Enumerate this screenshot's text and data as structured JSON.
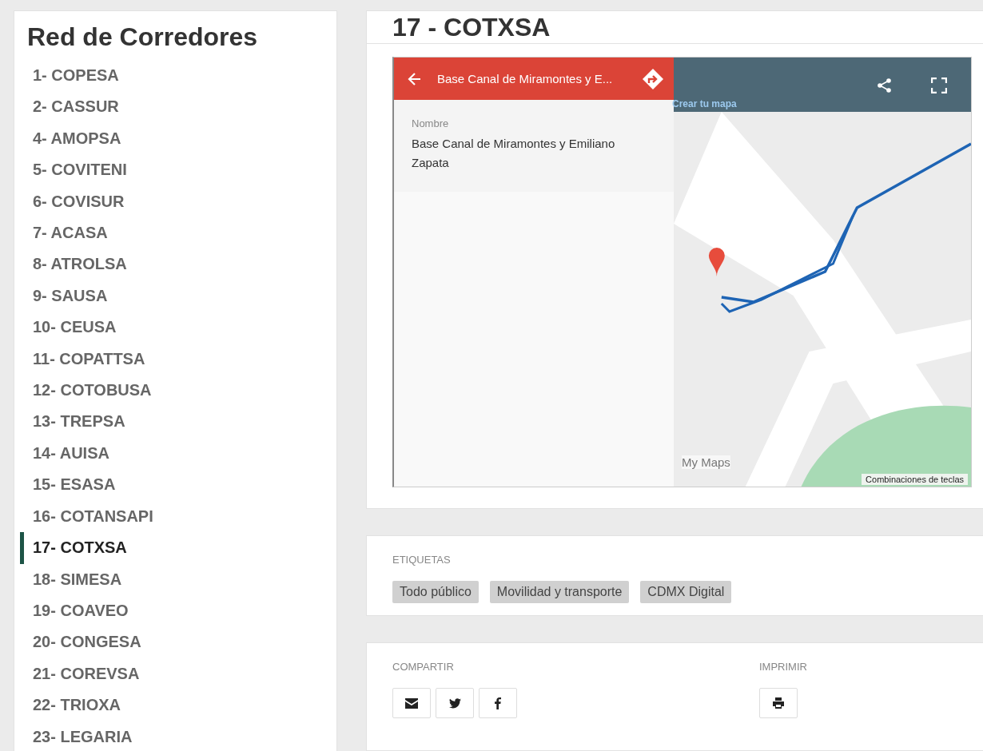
{
  "sidebar": {
    "title": "Red de Corredores",
    "items": [
      {
        "label": "1- COPESA",
        "selected": false
      },
      {
        "label": "2- CASSUR",
        "selected": false
      },
      {
        "label": "4- AMOPSA",
        "selected": false
      },
      {
        "label": "5- COVITENI",
        "selected": false
      },
      {
        "label": "6- COVISUR",
        "selected": false
      },
      {
        "label": "7- ACASA",
        "selected": false
      },
      {
        "label": "8- ATROLSA",
        "selected": false
      },
      {
        "label": "9- SAUSA",
        "selected": false
      },
      {
        "label": "10- CEUSA",
        "selected": false
      },
      {
        "label": "11- COPATTSA",
        "selected": false
      },
      {
        "label": "12- COTOBUSA",
        "selected": false
      },
      {
        "label": "13- TREPSA",
        "selected": false
      },
      {
        "label": "14- AUISA",
        "selected": false
      },
      {
        "label": "15- ESASA",
        "selected": false
      },
      {
        "label": "16- COTANSAPI",
        "selected": false
      },
      {
        "label": "17- COTXSA",
        "selected": true
      },
      {
        "label": "18- SIMESA",
        "selected": false
      },
      {
        "label": "19- COAVEO",
        "selected": false
      },
      {
        "label": "20- CONGESA",
        "selected": false
      },
      {
        "label": "21- COREVSA",
        "selected": false
      },
      {
        "label": "22- TRIOXA",
        "selected": false
      },
      {
        "label": "23- LEGARIA",
        "selected": false
      }
    ]
  },
  "page_title": "17 - COTXSA",
  "map": {
    "panel_title": "Base Canal de Miramontes y E...",
    "field_label": "Nombre",
    "field_value": "Base Canal de Miramontes y Emiliano Zapata",
    "create_link": "Crear tu mapa",
    "brand": "My Maps",
    "shortcuts": "Combinaciones de teclas"
  },
  "tags": {
    "heading": "ETIQUETAS",
    "items": [
      "Todo público",
      "Movilidad y transporte",
      "CDMX Digital"
    ]
  },
  "share": {
    "heading": "COMPARTIR",
    "buttons": [
      {
        "kind": "email"
      },
      {
        "kind": "twitter"
      },
      {
        "kind": "facebook"
      }
    ]
  },
  "print": {
    "heading": "IMPRIMIR"
  }
}
